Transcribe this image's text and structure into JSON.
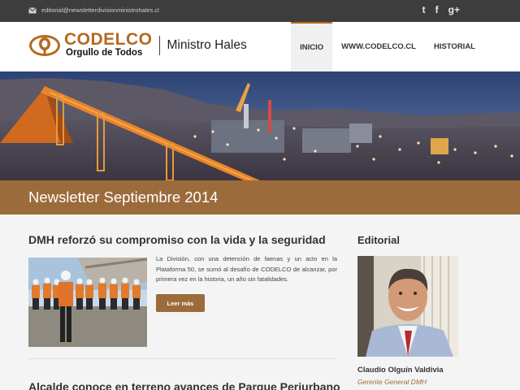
{
  "topbar": {
    "email": "editorial@newsletterdivisionministrohales.cl",
    "social": [
      {
        "icon": "twitter-icon",
        "glyph": "t"
      },
      {
        "icon": "facebook-icon",
        "glyph": "f"
      },
      {
        "icon": "google-plus-icon",
        "glyph": "g+"
      }
    ]
  },
  "header": {
    "brand": "CODELCO",
    "tagline": "Orgullo de Todos",
    "division": "Ministro Hales",
    "nav": [
      "INICIO",
      "WWW.CODELCO.CL",
      "HISTORIAL"
    ],
    "active_nav": "INICIO"
  },
  "banner": {
    "title": "Newsletter Septiembre 2014"
  },
  "main": {
    "article": {
      "title": "DMH reforzó su compromiso con la vida y la seguridad",
      "body": "La División, con una detención de faenas y un acto en la Plataforma 50, se sumó al desafío de CODELCO de alcanzar, por primera vez en la historia, un año sin fatalidades.",
      "button": "Leer más"
    },
    "article2": {
      "title": "Alcalde conoce en terreno avances de Parque Periurbano"
    }
  },
  "sidebar": {
    "heading": "Editorial",
    "name": "Claudio Olguín Valdivia",
    "role": "Gerente General DMH"
  },
  "colors": {
    "accent": "#9c6b3b",
    "brand": "#b4691f",
    "topbar": "#3d3d3d"
  }
}
